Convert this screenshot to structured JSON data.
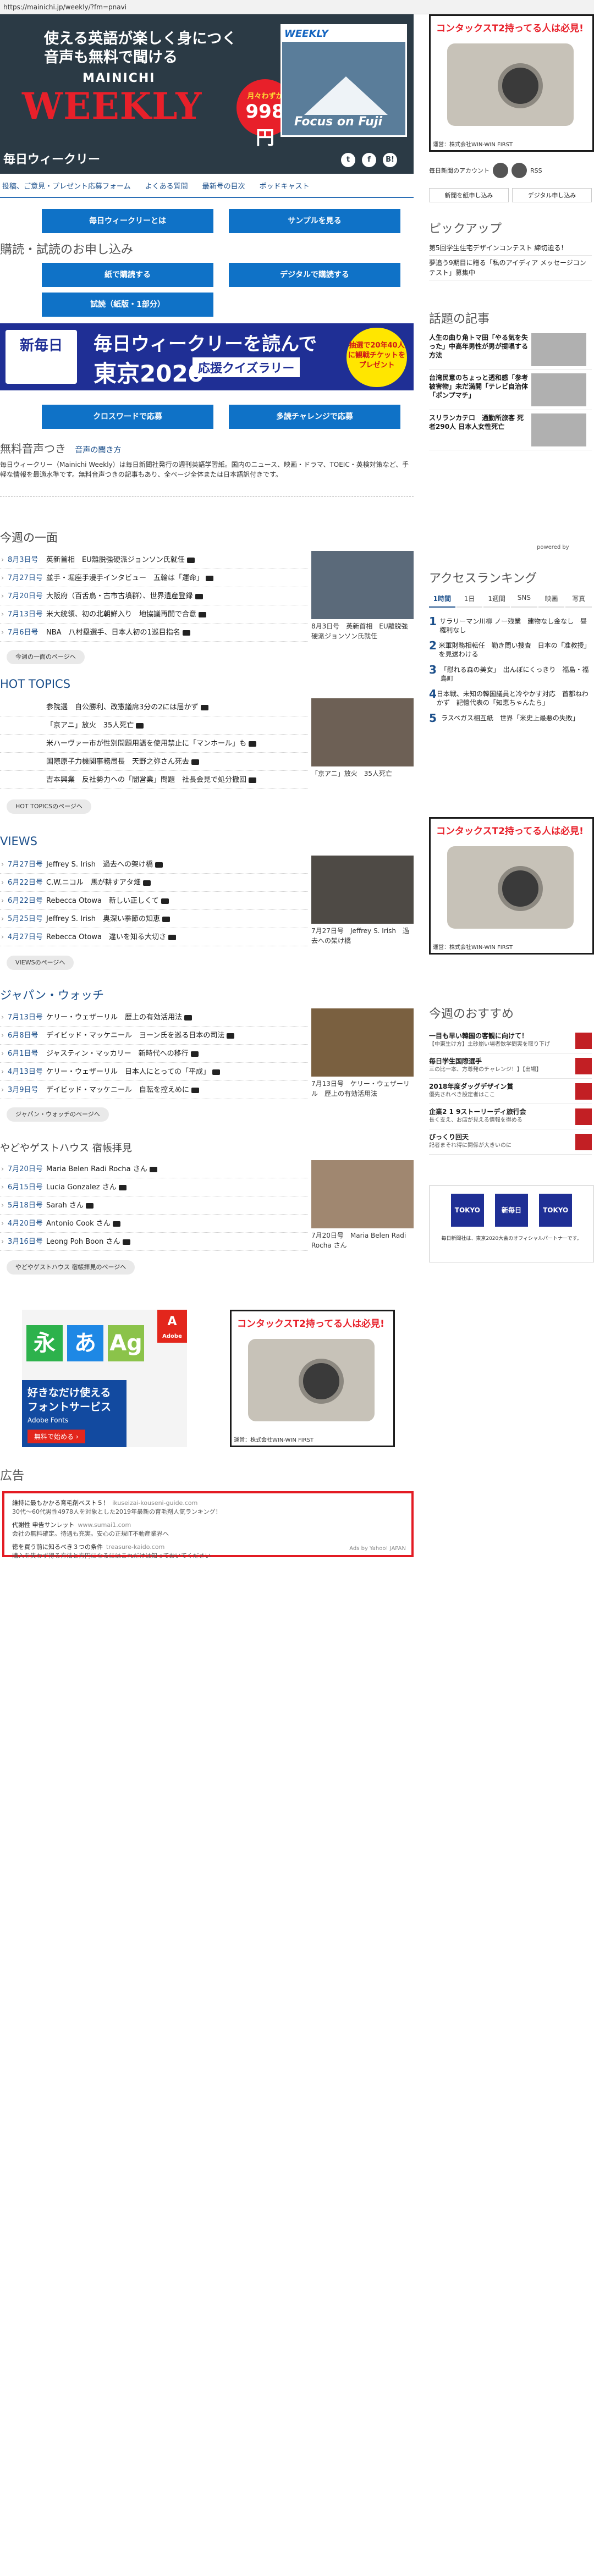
{
  "url": "https://mainichi.jp/weekly/?fm=pnavi",
  "hero": {
    "tagline_1": "使える英語が楽しく身につく",
    "tagline_2": "音声も無料で聞ける",
    "brand_top": "MAINICHI",
    "brand_main": "WEEKLY",
    "price_small": "月々わずか",
    "price_big": "998円",
    "magazine_title": "WEEKLY",
    "magazine_cover": "Focus on Fuji"
  },
  "title_bar": {
    "title": "毎日ウィークリー",
    "icons": [
      "twitter-icon",
      "facebook-icon",
      "hatena-icon"
    ]
  },
  "nav": [
    "投稿、ご意見・プレゼント応募フォーム",
    "よくある質問",
    "最新号の目次",
    "ポッドキャスト"
  ],
  "buttons": {
    "about": "毎日ウィークリーとは",
    "sample": "サンプルを見る",
    "paper": "紙で購読する",
    "digital": "デジタルで購読する",
    "trial": "試読（紙版・1部分）",
    "crossword": "クロスワードで応募",
    "challenge": "多読チャレンジで応募"
  },
  "apply_heading": "購読・試読のお申し込み",
  "olympic_banner": {
    "logo": "新毎日",
    "line1": "毎日ウィークリーを読んで",
    "line2": "東京2020",
    "line3": "応援クイズラリー",
    "badge": "抽選で20年40人に観戦チケットをプレゼント"
  },
  "audio": {
    "heading": "無料音声つき",
    "sub": "音声の聞き方",
    "body": "毎日ウィークリー（Mainichi Weekly）は毎日新聞社発行の週刊英語学習紙。国内のニュース、映画・ドラマ、TOEIC・英検対策など、手軽な情報を最適水準です。無料音声つきの記事もあり、全ページ全体または日本語訳付きです。"
  },
  "weekly_news": {
    "heading": "今週の一面",
    "rows": [
      {
        "date": "8月3日号",
        "text": "英新首相　EU離脱強硬派ジョンソン氏就任"
      },
      {
        "date": "7月27日号",
        "text": "並手・堀座手漫手インタビュー　五輪は「運命」"
      },
      {
        "date": "7月20日号",
        "text": "大阪府（百舌鳥・古市古墳群）、世界遺産登録"
      },
      {
        "date": "7月13日号",
        "text": "米大統領、初の北朝鮮入り　地協議再開で合意"
      },
      {
        "date": "7月6日号",
        "text": "NBA　八村塁選手、日本人初の1巡目指名"
      }
    ],
    "more": "今週の一面のページへ",
    "thumb_caption": "8月3日号　英新首相　EU離脱強硬派ジョンソン氏就任"
  },
  "hot_topics": {
    "heading": "HOT TOPICS",
    "rows": [
      {
        "date": "",
        "text": "参院選　自公勝利、改憲議席3分の2には届かず"
      },
      {
        "date": "",
        "text": "「京アニ」放火　35人死亡"
      },
      {
        "date": "",
        "text": "米ハーヴァー市が性別問題用語を使用禁止に「マンホール」も"
      },
      {
        "date": "",
        "text": "国際原子力機関事務局長　天野之弥さん死去"
      },
      {
        "date": "",
        "text": "吉本興業　反社勢力への「闇営業」問題　社長会見で処分撤回"
      }
    ],
    "more": "HOT TOPICSのページへ",
    "thumb_caption": "「京アニ」放火　35人死亡"
  },
  "views": {
    "heading": "VIEWS",
    "rows": [
      {
        "date": "7月27日号",
        "text": "Jeffrey S. Irish　過去への架け橋"
      },
      {
        "date": "6月22日号",
        "text": "C.W.ニコル　馬が耕すアタ畑"
      },
      {
        "date": "6月22日号",
        "text": "Rebecca Otowa　新しい正しくて"
      },
      {
        "date": "5月25日号",
        "text": "Jeffrey S. Irish　奥深い季節の知恵"
      },
      {
        "date": "4月27日号",
        "text": "Rebecca Otowa　違いを知る大切さ"
      }
    ],
    "more": "VIEWSのページへ",
    "thumb_caption": "7月27日号　Jeffrey S. Irish　過去への架け橋"
  },
  "japan_watch": {
    "heading": "ジャパン・ウォッチ",
    "rows": [
      {
        "date": "7月13日号",
        "text": "ケリー・ウェザーリル　歴上の有効活用法"
      },
      {
        "date": "6月8日号",
        "text": "デイビッド・マッケニール　ヨーン氏を巡る日本の司法"
      },
      {
        "date": "6月1日号",
        "text": "ジャスティン・マッカリー　新時代への移行"
      },
      {
        "date": "4月13日号",
        "text": "ケリー・ウェザーリル　日本人にとっての「平成」"
      },
      {
        "date": "3月9日号",
        "text": "デイビッド・マッケニール　自転を控えめに"
      }
    ],
    "more": "ジャパン・ウォッチのページへ",
    "thumb_caption": "7月13日号　ケリー・ウェザーリル　歴上の有効活用法"
  },
  "guesthouse": {
    "heading": "やどやゲストハウス 宿帳拝見",
    "rows": [
      {
        "date": "7月20日号",
        "text": "Maria Belen Radi Rocha さん"
      },
      {
        "date": "6月15日号",
        "text": "Lucia Gonzalez さん"
      },
      {
        "date": "5月18日号",
        "text": "Sarah さん"
      },
      {
        "date": "4月20日号",
        "text": "Antonio Cook さん"
      },
      {
        "date": "3月16日号",
        "text": "Leong Poh Boon さん"
      }
    ],
    "more": "やどやゲストハウス 宿帳拝見のページへ",
    "thumb_caption": "7月20日号　Maria Belen Radi Rocha さん"
  },
  "ad_fonts": {
    "title": "好きなだけ使える フォントサービス",
    "brand": "Adobe Fonts",
    "cta": "無料で始める ›",
    "logo": "Adobe"
  },
  "ad_camera": {
    "headline": "コンタックスT2持ってる人は必見!",
    "footer": "運営：株式会社WIN-WIN FIRST"
  },
  "ads": {
    "heading": "広告",
    "items": [
      {
        "title": "維持に最もかかる育毛剤ベスト５！",
        "url": "ikuseizai-kouseni-guide.com",
        "desc": "30代～60代男性4978人を対象とした2019年最新の育毛剤人気ランキング！"
      },
      {
        "title": "代謝性 申告サンレット",
        "url": "www.sumai1.com",
        "desc": "会社の無料確定。待遇も充実。安心の正規IT不動産業界へ"
      },
      {
        "title": "徳を買う前に知るべき３つの条件",
        "url": "treasure-kaido.com",
        "desc": "購入を失わず得る方法と方円になるにはこれだけは知っておいてください"
      }
    ],
    "provider": "Ads by Yahoo! JAPAN"
  },
  "sidebar": {
    "follow_label": "毎日新聞のアカウント",
    "rss": "RSS",
    "subscribe_new": "新聞を紙申し込み",
    "subscribe_digital": "デジタル申し込み",
    "pickup_heading": "ピックアップ",
    "pickup": [
      {
        "title": "第5回学生住宅デザインコンテスト 締切迫る！"
      },
      {
        "title": "夢追う9期目に贈る「私のアイディア メッセージコンテスト」募集中"
      }
    ],
    "topics_heading": "話題の記事",
    "topics": [
      {
        "title": "人生の曲り角トマ田「やる気を失った」中高年男性が男が提唱する方法"
      },
      {
        "title": "台湾民意のちょっと透和感「参考被害物」未だ満開「テレビ自治体「ポンプマチ」"
      },
      {
        "title": "スリランカテロ　通勤所旅客 死者290人 日本人女性死亡"
      }
    ],
    "powered": "powered by",
    "ranking_heading": "アクセスランキング",
    "ranking_tabs": [
      "1時間",
      "1日",
      "1週間",
      "SNS",
      "映画",
      "写真"
    ],
    "ranking": [
      {
        "n": "1",
        "t": "サラリーマン川柳 ノー残業　建物なし金なし　昼権利なし"
      },
      {
        "n": "2",
        "t": "米軍財務相転任　勤き問い捜査　日本の「准教授」を見送わける"
      },
      {
        "n": "3",
        "t": "「慰れる森の美女」　出んぼにくっきり　福島・福島町"
      },
      {
        "n": "4",
        "t": "日本戦、未知の韓国議員と冷やかす対応　首都ねわかず　記憶代表の「知恵ちゃんたら」"
      },
      {
        "n": "5",
        "t": "ラスベガス相互紙　世界「米史上最悪の失敗」"
      }
    ],
    "rec_heading": "今週のおすすめ",
    "rec": [
      {
        "t": "一目も早い韓国の客観に向けて！",
        "d": "【中東生け方】土砂崩い場者数学問実を取り下げ"
      },
      {
        "t": "毎日学生国際選手",
        "d": "三の比一本、方尊発のチャレンジ！】【出場】"
      },
      {
        "t": "2018年度ダッグデザイン賞",
        "d": "優先されべき設定者はここ"
      },
      {
        "t": "企業2 1 9ストーリーディ旅行会",
        "d": "長く支え、お店が見える情報を得める"
      },
      {
        "t": "びっくり回天",
        "d": "記者まそれ得に関係が大きいのに"
      }
    ],
    "olympic_small_logo": "新毎日",
    "olympic_small_caption": "毎日新聞社は、東京2020大会のオフィシャルパートナーです。"
  }
}
